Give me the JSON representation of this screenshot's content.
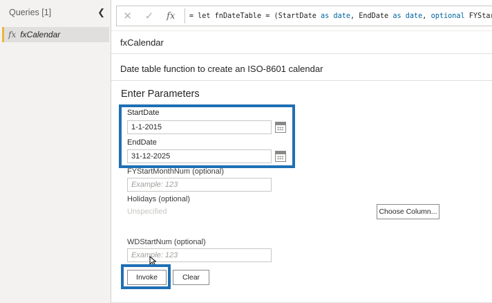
{
  "sidebar": {
    "title": "Queries [1]",
    "collapse_icon": "chevron-left-icon",
    "query": {
      "icon": "fx-icon",
      "fx_glyph": "fx",
      "label": "fxCalendar"
    }
  },
  "formula_bar": {
    "cancel_glyph": "✕",
    "confirm_glyph": "✓",
    "fx_glyph": "fx",
    "parts": [
      {
        "t": "= let fnDateTable = (StartDate ",
        "kw": false
      },
      {
        "t": "as",
        "kw": true
      },
      {
        "t": " ",
        "kw": false
      },
      {
        "t": "date",
        "kw": true
      },
      {
        "t": ", EndDate ",
        "kw": false
      },
      {
        "t": "as",
        "kw": true
      },
      {
        "t": " ",
        "kw": false
      },
      {
        "t": "date",
        "kw": true
      },
      {
        "t": ", ",
        "kw": false
      },
      {
        "t": "optional",
        "kw": true
      },
      {
        "t": " FYStart",
        "kw": false
      }
    ]
  },
  "function": {
    "name": "fxCalendar",
    "description": "Date table function to create an ISO-8601 calendar"
  },
  "params": {
    "heading": "Enter Parameters",
    "start_date": {
      "label": "StartDate",
      "value": "1-1-2015"
    },
    "end_date": {
      "label": "EndDate",
      "value": "31-12-2025"
    },
    "fy_start": {
      "label": "FYStartMonthNum (optional)",
      "placeholder": "Example: 123"
    },
    "holidays": {
      "label": "Holidays (optional)",
      "value": "Unspecified",
      "button": "Choose Column..."
    },
    "wd_start": {
      "label": "WDStartNum (optional)",
      "placeholder": "Example: 123"
    }
  },
  "actions": {
    "invoke": "Invoke",
    "clear": "Clear"
  },
  "colors": {
    "highlight": "#1f6fb5",
    "keyword": "#0064a0",
    "query_marker": "#e8b73a"
  }
}
